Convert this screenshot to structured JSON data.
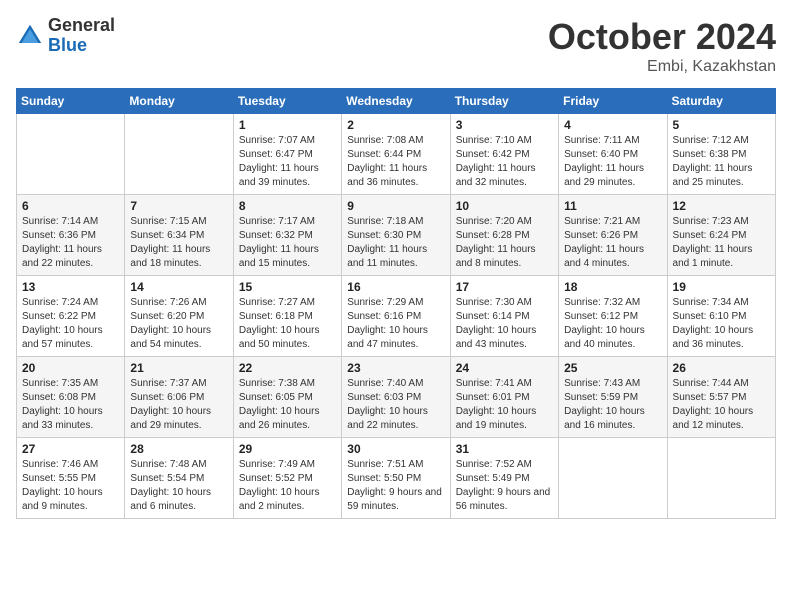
{
  "logo": {
    "general": "General",
    "blue": "Blue"
  },
  "title": {
    "month": "October 2024",
    "location": "Embi, Kazakhstan"
  },
  "headers": [
    "Sunday",
    "Monday",
    "Tuesday",
    "Wednesday",
    "Thursday",
    "Friday",
    "Saturday"
  ],
  "weeks": [
    [
      {
        "day": "",
        "sunrise": "",
        "sunset": "",
        "daylight": ""
      },
      {
        "day": "",
        "sunrise": "",
        "sunset": "",
        "daylight": ""
      },
      {
        "day": "1",
        "sunrise": "Sunrise: 7:07 AM",
        "sunset": "Sunset: 6:47 PM",
        "daylight": "Daylight: 11 hours and 39 minutes."
      },
      {
        "day": "2",
        "sunrise": "Sunrise: 7:08 AM",
        "sunset": "Sunset: 6:44 PM",
        "daylight": "Daylight: 11 hours and 36 minutes."
      },
      {
        "day": "3",
        "sunrise": "Sunrise: 7:10 AM",
        "sunset": "Sunset: 6:42 PM",
        "daylight": "Daylight: 11 hours and 32 minutes."
      },
      {
        "day": "4",
        "sunrise": "Sunrise: 7:11 AM",
        "sunset": "Sunset: 6:40 PM",
        "daylight": "Daylight: 11 hours and 29 minutes."
      },
      {
        "day": "5",
        "sunrise": "Sunrise: 7:12 AM",
        "sunset": "Sunset: 6:38 PM",
        "daylight": "Daylight: 11 hours and 25 minutes."
      }
    ],
    [
      {
        "day": "6",
        "sunrise": "Sunrise: 7:14 AM",
        "sunset": "Sunset: 6:36 PM",
        "daylight": "Daylight: 11 hours and 22 minutes."
      },
      {
        "day": "7",
        "sunrise": "Sunrise: 7:15 AM",
        "sunset": "Sunset: 6:34 PM",
        "daylight": "Daylight: 11 hours and 18 minutes."
      },
      {
        "day": "8",
        "sunrise": "Sunrise: 7:17 AM",
        "sunset": "Sunset: 6:32 PM",
        "daylight": "Daylight: 11 hours and 15 minutes."
      },
      {
        "day": "9",
        "sunrise": "Sunrise: 7:18 AM",
        "sunset": "Sunset: 6:30 PM",
        "daylight": "Daylight: 11 hours and 11 minutes."
      },
      {
        "day": "10",
        "sunrise": "Sunrise: 7:20 AM",
        "sunset": "Sunset: 6:28 PM",
        "daylight": "Daylight: 11 hours and 8 minutes."
      },
      {
        "day": "11",
        "sunrise": "Sunrise: 7:21 AM",
        "sunset": "Sunset: 6:26 PM",
        "daylight": "Daylight: 11 hours and 4 minutes."
      },
      {
        "day": "12",
        "sunrise": "Sunrise: 7:23 AM",
        "sunset": "Sunset: 6:24 PM",
        "daylight": "Daylight: 11 hours and 1 minute."
      }
    ],
    [
      {
        "day": "13",
        "sunrise": "Sunrise: 7:24 AM",
        "sunset": "Sunset: 6:22 PM",
        "daylight": "Daylight: 10 hours and 57 minutes."
      },
      {
        "day": "14",
        "sunrise": "Sunrise: 7:26 AM",
        "sunset": "Sunset: 6:20 PM",
        "daylight": "Daylight: 10 hours and 54 minutes."
      },
      {
        "day": "15",
        "sunrise": "Sunrise: 7:27 AM",
        "sunset": "Sunset: 6:18 PM",
        "daylight": "Daylight: 10 hours and 50 minutes."
      },
      {
        "day": "16",
        "sunrise": "Sunrise: 7:29 AM",
        "sunset": "Sunset: 6:16 PM",
        "daylight": "Daylight: 10 hours and 47 minutes."
      },
      {
        "day": "17",
        "sunrise": "Sunrise: 7:30 AM",
        "sunset": "Sunset: 6:14 PM",
        "daylight": "Daylight: 10 hours and 43 minutes."
      },
      {
        "day": "18",
        "sunrise": "Sunrise: 7:32 AM",
        "sunset": "Sunset: 6:12 PM",
        "daylight": "Daylight: 10 hours and 40 minutes."
      },
      {
        "day": "19",
        "sunrise": "Sunrise: 7:34 AM",
        "sunset": "Sunset: 6:10 PM",
        "daylight": "Daylight: 10 hours and 36 minutes."
      }
    ],
    [
      {
        "day": "20",
        "sunrise": "Sunrise: 7:35 AM",
        "sunset": "Sunset: 6:08 PM",
        "daylight": "Daylight: 10 hours and 33 minutes."
      },
      {
        "day": "21",
        "sunrise": "Sunrise: 7:37 AM",
        "sunset": "Sunset: 6:06 PM",
        "daylight": "Daylight: 10 hours and 29 minutes."
      },
      {
        "day": "22",
        "sunrise": "Sunrise: 7:38 AM",
        "sunset": "Sunset: 6:05 PM",
        "daylight": "Daylight: 10 hours and 26 minutes."
      },
      {
        "day": "23",
        "sunrise": "Sunrise: 7:40 AM",
        "sunset": "Sunset: 6:03 PM",
        "daylight": "Daylight: 10 hours and 22 minutes."
      },
      {
        "day": "24",
        "sunrise": "Sunrise: 7:41 AM",
        "sunset": "Sunset: 6:01 PM",
        "daylight": "Daylight: 10 hours and 19 minutes."
      },
      {
        "day": "25",
        "sunrise": "Sunrise: 7:43 AM",
        "sunset": "Sunset: 5:59 PM",
        "daylight": "Daylight: 10 hours and 16 minutes."
      },
      {
        "day": "26",
        "sunrise": "Sunrise: 7:44 AM",
        "sunset": "Sunset: 5:57 PM",
        "daylight": "Daylight: 10 hours and 12 minutes."
      }
    ],
    [
      {
        "day": "27",
        "sunrise": "Sunrise: 7:46 AM",
        "sunset": "Sunset: 5:55 PM",
        "daylight": "Daylight: 10 hours and 9 minutes."
      },
      {
        "day": "28",
        "sunrise": "Sunrise: 7:48 AM",
        "sunset": "Sunset: 5:54 PM",
        "daylight": "Daylight: 10 hours and 6 minutes."
      },
      {
        "day": "29",
        "sunrise": "Sunrise: 7:49 AM",
        "sunset": "Sunset: 5:52 PM",
        "daylight": "Daylight: 10 hours and 2 minutes."
      },
      {
        "day": "30",
        "sunrise": "Sunrise: 7:51 AM",
        "sunset": "Sunset: 5:50 PM",
        "daylight": "Daylight: 9 hours and 59 minutes."
      },
      {
        "day": "31",
        "sunrise": "Sunrise: 7:52 AM",
        "sunset": "Sunset: 5:49 PM",
        "daylight": "Daylight: 9 hours and 56 minutes."
      },
      {
        "day": "",
        "sunrise": "",
        "sunset": "",
        "daylight": ""
      },
      {
        "day": "",
        "sunrise": "",
        "sunset": "",
        "daylight": ""
      }
    ]
  ]
}
